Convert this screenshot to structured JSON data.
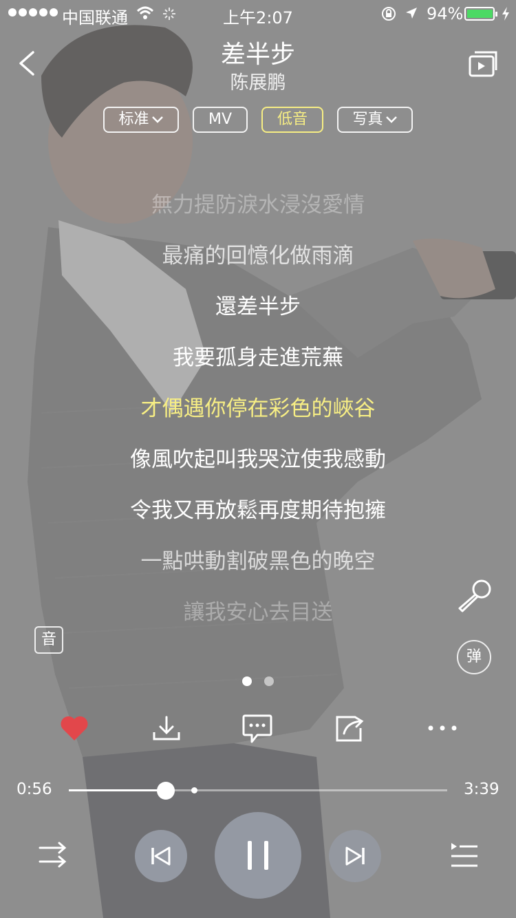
{
  "status_bar": {
    "carrier": "中国联通",
    "time": "上午2:07",
    "battery": "94%"
  },
  "song": {
    "title": "差半步",
    "artist": "陈展鹏"
  },
  "options": [
    {
      "label": "标准",
      "has_dropdown": true,
      "active": false
    },
    {
      "label": "MV",
      "has_dropdown": false,
      "active": false
    },
    {
      "label": "低音",
      "has_dropdown": false,
      "active": true
    },
    {
      "label": "写真",
      "has_dropdown": true,
      "active": false
    }
  ],
  "lyrics": [
    {
      "text": "無力提防淚水浸沒愛情"
    },
    {
      "text": "最痛的回憶化做雨滴"
    },
    {
      "text": "還差半步"
    },
    {
      "text": "我要孤身走進荒蕪"
    },
    {
      "text": "才偶遇你停在彩色的峽谷"
    },
    {
      "text": "像風吹起叫我哭泣使我感動"
    },
    {
      "text": "令我又再放鬆再度期待抱擁"
    },
    {
      "text": "一點哄動割破黑色的晚空"
    },
    {
      "text": "讓我安心去目送"
    }
  ],
  "side": {
    "sound_label": "音",
    "danmaku_label": "弹"
  },
  "progress": {
    "elapsed": "0:56",
    "total": "3:39",
    "played_fraction": 0.256,
    "buffered_fraction": 0.33
  },
  "colors": {
    "accent_yellow": "#f7ee84",
    "heart_red": "#e2474b",
    "background_gray": "#8e8e8e",
    "battery_green": "#4cd964"
  },
  "icons": {
    "back": "back-chevron-icon",
    "cast": "cast-icon",
    "mic": "microphone-icon",
    "like": "heart-icon",
    "download": "download-icon",
    "comment": "comment-icon",
    "share": "share-icon",
    "more": "more-icon",
    "shuffle": "shuffle-icon",
    "prev": "previous-icon",
    "pause": "pause-icon",
    "next": "next-icon",
    "playlist": "playlist-icon"
  }
}
